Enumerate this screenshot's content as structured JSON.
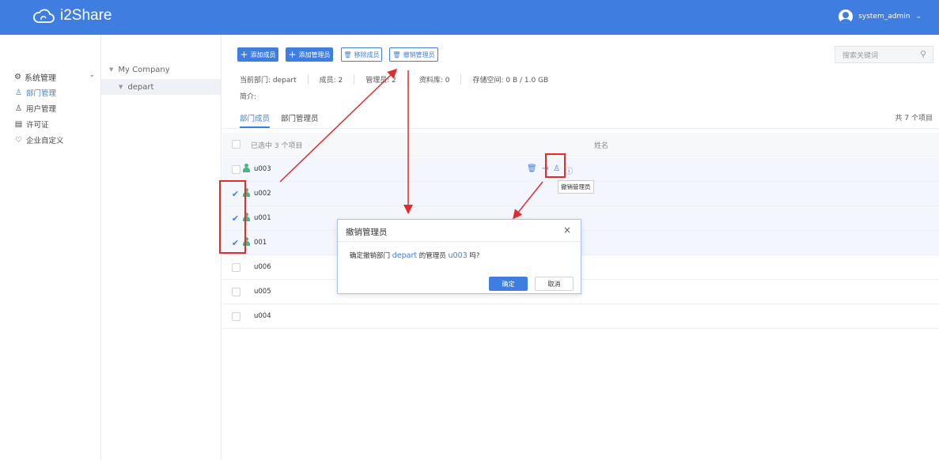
{
  "header": {
    "app_name": "i2Share",
    "user_name": "system_admin",
    "user_chevron": "⌄"
  },
  "sidebar": {
    "group_label": "系统管理",
    "items": [
      {
        "label": "部门管理",
        "icon": "department-icon"
      },
      {
        "label": "用户管理",
        "icon": "user-icon"
      },
      {
        "label": "许可证",
        "icon": "license-icon"
      },
      {
        "label": "企业自定义",
        "icon": "customize-icon"
      }
    ]
  },
  "tree": {
    "root": "My Company",
    "child": "depart"
  },
  "toolbar": {
    "add_member": "添加成员",
    "add_admin": "添加管理员",
    "remove_member": "移除成员",
    "revoke_admin": "撤销管理员",
    "search_placeholder": "搜索关键词"
  },
  "info": {
    "department": "当前部门: depart",
    "members": "成员: 2",
    "admins": "管理员: 2",
    "libraries": "资料库: 0",
    "storage": "存储空间: 0 B / 1.0 GB",
    "intro": "简介:"
  },
  "tabs": {
    "members": "部门成员",
    "admins": "部门管理员",
    "total": "共 7 个项目"
  },
  "table": {
    "selected": "已选中 3 个项目",
    "name_column": "姓名",
    "rows": [
      {
        "name": "u003",
        "checked": false,
        "has_icon": true
      },
      {
        "name": "u002",
        "checked": true,
        "has_icon": true
      },
      {
        "name": "u001",
        "checked": true,
        "has_icon": true
      },
      {
        "name": "001",
        "checked": true,
        "has_icon": true
      },
      {
        "name": "u006",
        "checked": false,
        "has_icon": false
      },
      {
        "name": "u005",
        "checked": false,
        "has_icon": false
      },
      {
        "name": "u004",
        "checked": false,
        "has_icon": false
      }
    ],
    "tooltip": "撤销管理员"
  },
  "dialog": {
    "title": "撤销管理员",
    "message_prefix": "确定撤销部门",
    "department": "depart",
    "message_middle": "的管理员",
    "user": "u003",
    "message_suffix": "吗?",
    "ok": "确定",
    "cancel": "取消"
  },
  "colors": {
    "primary": "#3f7ee0",
    "annotation": "#e02c2c",
    "user_icon": "#42b983"
  }
}
